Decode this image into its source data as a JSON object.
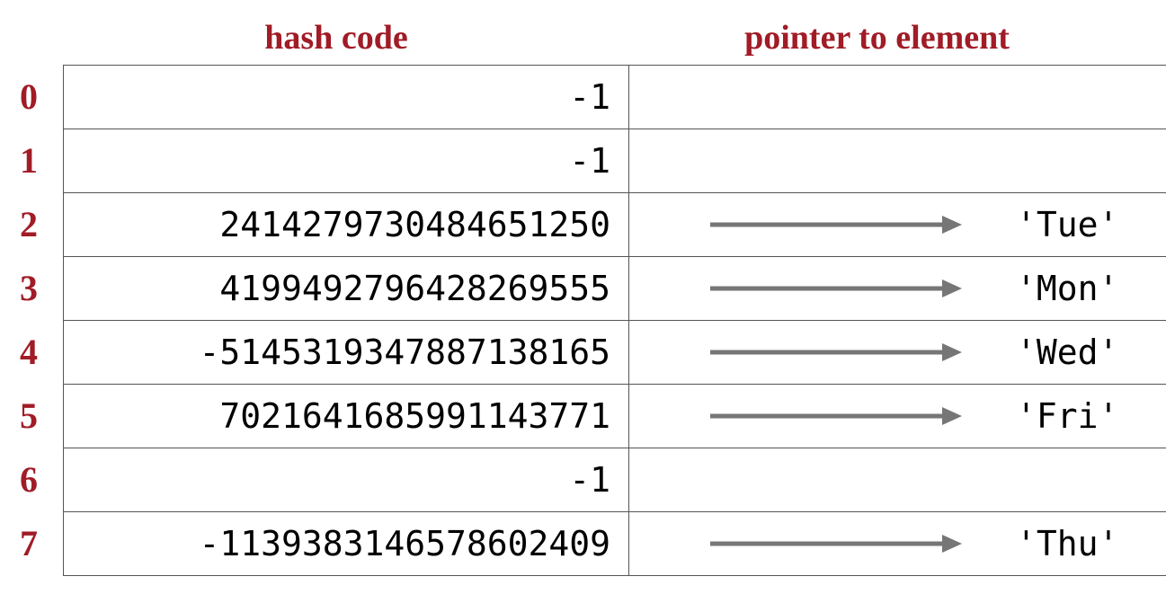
{
  "headers": {
    "hash": "hash code",
    "pointer": "pointer to element"
  },
  "rows": [
    {
      "index": "0",
      "hash": "-1",
      "has_ptr": false,
      "value": ""
    },
    {
      "index": "1",
      "hash": "-1",
      "has_ptr": false,
      "value": ""
    },
    {
      "index": "2",
      "hash": "2414279730484651250",
      "has_ptr": true,
      "value": "'Tue'"
    },
    {
      "index": "3",
      "hash": "4199492796428269555",
      "has_ptr": true,
      "value": "'Mon'"
    },
    {
      "index": "4",
      "hash": "-5145319347887138165",
      "has_ptr": true,
      "value": "'Wed'"
    },
    {
      "index": "5",
      "hash": "7021641685991143771",
      "has_ptr": true,
      "value": "'Fri'"
    },
    {
      "index": "6",
      "hash": "-1",
      "has_ptr": false,
      "value": ""
    },
    {
      "index": "7",
      "hash": "-1139383146578602409",
      "has_ptr": true,
      "value": "'Thu'"
    }
  ]
}
